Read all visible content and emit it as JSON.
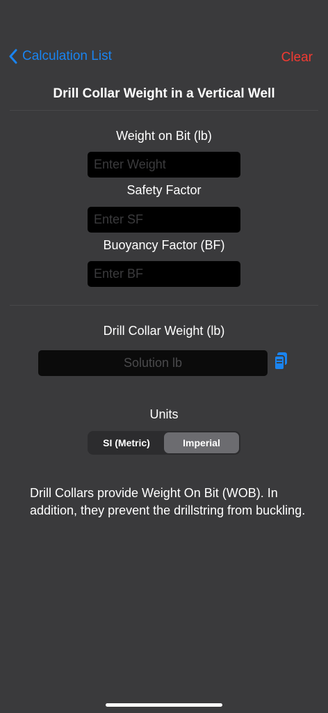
{
  "nav": {
    "back_label": "Calculation List",
    "clear_label": "Clear"
  },
  "title": "Drill Collar Weight in a Vertical Well",
  "inputs": [
    {
      "label": "Weight on Bit (lb)",
      "placeholder": "Enter Weight",
      "value": ""
    },
    {
      "label": "Safety Factor",
      "placeholder": "Enter SF",
      "value": ""
    },
    {
      "label": "Buoyancy Factor (BF)",
      "placeholder": "Enter BF",
      "value": ""
    }
  ],
  "result": {
    "label": "Drill Collar Weight (lb)",
    "placeholder": "Solution lb",
    "copy_icon": "copy-icon"
  },
  "units": {
    "label": "Units",
    "options": [
      "SI (Metric)",
      "Imperial"
    ],
    "selected": "Imperial"
  },
  "description": "Drill Collars provide Weight On Bit (WOB). In addition, they prevent the drillstring from buckling.",
  "colors": {
    "background": "#3a3a3c",
    "accent_blue": "#1a84f0",
    "destructive_red": "#f23a32",
    "field_background": "#000000"
  }
}
